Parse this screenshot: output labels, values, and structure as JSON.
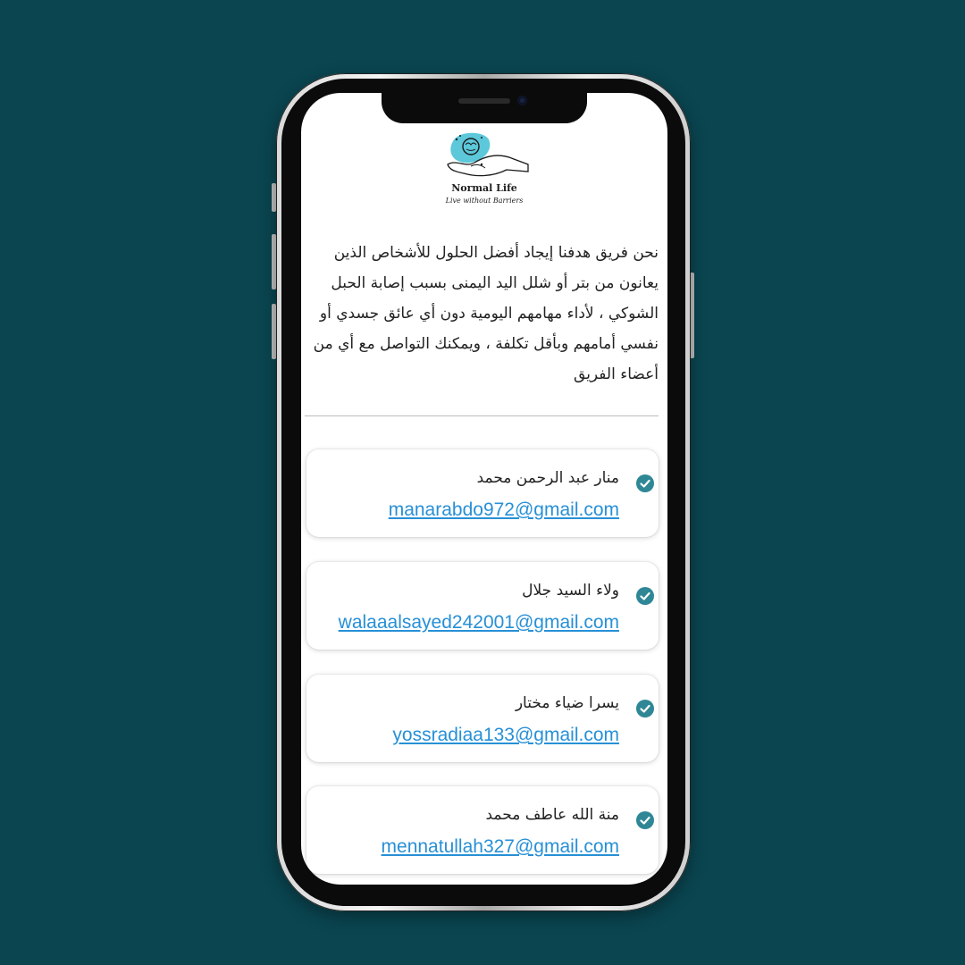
{
  "app": {
    "brand": "Normal Life",
    "tagline": "Live without Barriers",
    "logo_icon": "hand-with-brain-logo-icon",
    "accent_color": "#2f8796",
    "link_color": "#2790d6",
    "background_color": "#0a4550"
  },
  "intro": {
    "text": "نحن فريق هدفنا إيجاد أفضل الحلول للأشخاص الذين يعانون من بتر أو شلل اليد اليمنى بسبب إصابة الحبل الشوكي ، لأداء مهامهم اليومية دون أي عائق جسدي أو نفسي أمامهم وبأقل تكلفة ، ويمكنك التواصل مع أي من أعضاء الفريق"
  },
  "contacts": [
    {
      "name": "منار عبد الرحمن محمد",
      "email": "manarabdo972@gmail.com",
      "icon": "check-circle-icon"
    },
    {
      "name": "ولاء السيد جلال",
      "email": "walaaalsayed242001@gmail.com",
      "icon": "check-circle-icon"
    },
    {
      "name": "يسرا ضياء مختار",
      "email": "yossradiaa133@gmail.com",
      "icon": "check-circle-icon"
    },
    {
      "name": "منة الله عاطف محمد",
      "email": "mennatullah327@gmail.com",
      "icon": "check-circle-icon"
    }
  ]
}
